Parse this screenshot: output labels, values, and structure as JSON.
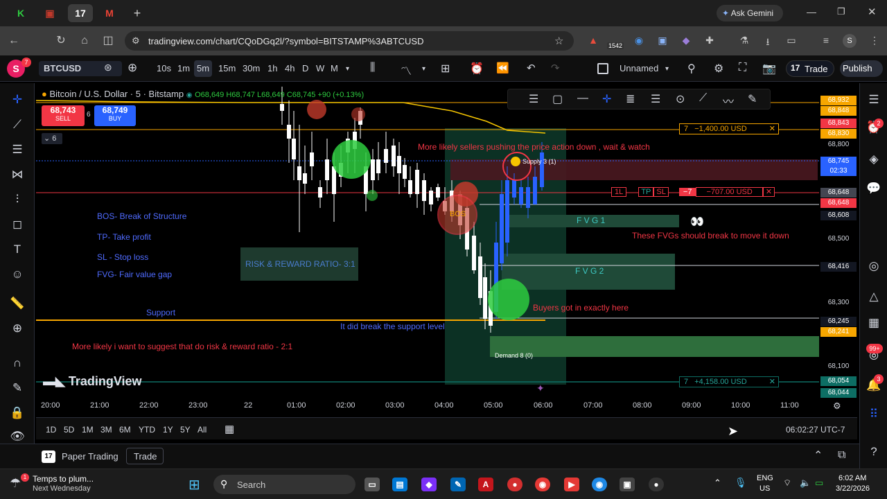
{
  "browser": {
    "url": "tradingview.com/chart/CQoDGq2l/?symbol=BITSTAMP%3ABTCUSD",
    "ask_gemini": "Ask Gemini",
    "ext_badge": "1542"
  },
  "toolbar": {
    "avatar_letter": "S",
    "avatar_badge": "7",
    "symbol": "BTCUSD",
    "intervals": [
      "10s",
      "1m",
      "5m",
      "15m",
      "30m",
      "1h",
      "4h",
      "D",
      "W",
      "M"
    ],
    "active_interval": "5m",
    "layout_name": "Unnamed",
    "trade_label": "Trade",
    "publish_label": "Publish"
  },
  "legend": {
    "title": "Bitcoin / U.S. Dollar · 5 · Bitstamp",
    "ohlc": "O68,649 H68,747 L68,649 C68,745 +90 (+0.13%)",
    "sell_price": "68,743",
    "sell_label": "SELL",
    "spread": "6",
    "buy_price": "68,749",
    "buy_label": "BUY",
    "indicator_count": "6"
  },
  "annotations": {
    "bos": "BOS- Break of Structure",
    "tp": "TP- Take profit",
    "sl": "SL - Stop loss",
    "fvg": "FVG- Fair value gap",
    "support": "Support",
    "rr_box": "RISK & REWARD RATIO- 3:1",
    "suggest": "More likely i want to suggest that do risk & reward ratio - 2:1",
    "support_break": "It did break the support level",
    "sellers": "More likely sellers pushing the price action down , wait & watch",
    "fvg_break": "These FVGs should break to move it down",
    "buyers": "Buyers got in exactly here",
    "fvg1": "F V G 1",
    "fvg2": "F V G 2",
    "bos_tag": "BOS",
    "supply": "Supply 3 (1)",
    "demand": "Demand 8 (0)",
    "eyes": "👀"
  },
  "orders": {
    "tp_qty": "7",
    "tp_pnl": "−1,400.00 USD",
    "pos_qty": "1L",
    "pos_tp": "TP",
    "pos_sl": "SL",
    "pos_num": "−7",
    "pos_pnl": "−707.00 USD",
    "sl_qty": "7",
    "sl_pnl": "+4,158.00 USD"
  },
  "price_axis": {
    "labels": [
      {
        "text": "68,932",
        "bg": "#f7a600"
      },
      {
        "text": "68,848",
        "bg": "#f7a600"
      },
      {
        "text": "68,843",
        "bg": "#f23645"
      },
      {
        "text": "68,830",
        "bg": "#f7a600"
      },
      {
        "text": "68,800",
        "bg": ""
      },
      {
        "text": "68,745",
        "bg": "#2962ff"
      },
      {
        "text": "02:33",
        "bg": "#2962ff"
      },
      {
        "text": "68,648",
        "bg": "#434651"
      },
      {
        "text": "68,648",
        "bg": "#f23645"
      },
      {
        "text": "68,608",
        "bg": "#131722"
      },
      {
        "text": "68,500",
        "bg": ""
      },
      {
        "text": "68,416",
        "bg": "#131722"
      },
      {
        "text": "68,300",
        "bg": ""
      },
      {
        "text": "68,245",
        "bg": "#131722"
      },
      {
        "text": "68,241",
        "bg": "#f7a600"
      },
      {
        "text": "68,100",
        "bg": ""
      },
      {
        "text": "68,054",
        "bg": "#0d6e64"
      },
      {
        "text": "68,044",
        "bg": "#0d6e64"
      }
    ]
  },
  "time_axis": [
    "20:00",
    "21:00",
    "22:00",
    "23:00",
    "22",
    "01:00",
    "02:00",
    "03:00",
    "04:00",
    "05:00",
    "06:00",
    "07:00",
    "08:00",
    "09:00",
    "10:00",
    "11:00"
  ],
  "ranges": [
    "1D",
    "5D",
    "1M",
    "3M",
    "6M",
    "YTD",
    "1Y",
    "5Y",
    "All"
  ],
  "clock": "06:02:27 UTC-7",
  "panel": {
    "paper_trading": "Paper Trading",
    "trade": "Trade"
  },
  "watermark": "TradingView",
  "right_badges": {
    "alerts": "2",
    "news": "99+",
    "notif": "3"
  },
  "taskbar": {
    "weather_title": "Temps to plum...",
    "weather_sub": "Next Wednesday",
    "search": "Search",
    "lang1": "ENG",
    "lang2": "US",
    "time": "6:02 AM",
    "date": "3/22/2026"
  }
}
